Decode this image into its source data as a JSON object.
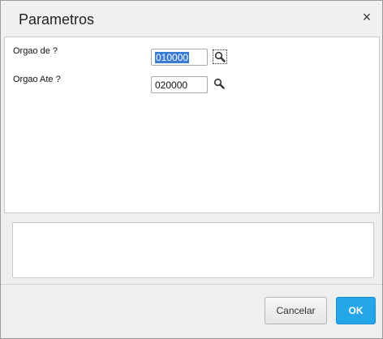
{
  "dialog": {
    "title": "Parametros",
    "close_glyph": "×"
  },
  "params": [
    {
      "label": "Orgao de ?",
      "value": "010000",
      "icon": "search-icon"
    },
    {
      "label": "Orgao Ate ?",
      "value": "020000",
      "icon": "search-icon"
    }
  ],
  "memo": {
    "value": ""
  },
  "footer": {
    "cancel_label": "Cancelar",
    "ok_label": "OK"
  },
  "colors": {
    "accent": "#24a6e8",
    "selection": "#3a7bd5"
  }
}
